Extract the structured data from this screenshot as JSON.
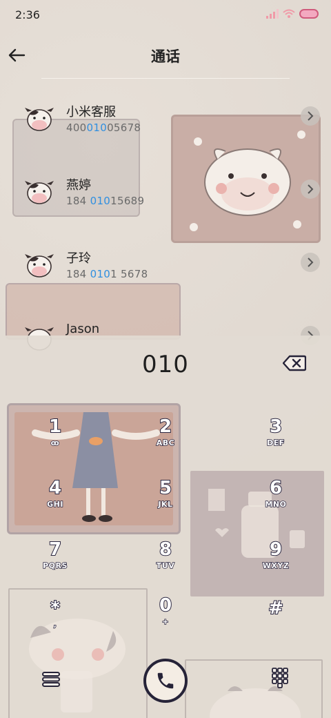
{
  "status_bar": {
    "time": "2:36"
  },
  "header": {
    "title": "通话"
  },
  "contacts": [
    {
      "name": "小米客服",
      "number_pre": "400",
      "number_hl": "010",
      "number_post": "05678"
    },
    {
      "name": "燕婷",
      "number_pre": "184 ",
      "number_hl": "010",
      "number_post": "15689"
    },
    {
      "name": "子玲",
      "number_pre": "184 ",
      "number_hl": "010",
      "number_post": "1 5678"
    },
    {
      "name": "Jason",
      "number_pre": "",
      "number_hl": "",
      "number_post": ""
    }
  ],
  "dialer": {
    "display": "010",
    "keys": [
      {
        "digit": "1",
        "letters": "ꝏ"
      },
      {
        "digit": "2",
        "letters": "ABC"
      },
      {
        "digit": "3",
        "letters": "DEF"
      },
      {
        "digit": "4",
        "letters": "GHI"
      },
      {
        "digit": "5",
        "letters": "JKL"
      },
      {
        "digit": "6",
        "letters": "MNO"
      },
      {
        "digit": "7",
        "letters": "PQRS"
      },
      {
        "digit": "8",
        "letters": "TUV"
      },
      {
        "digit": "9",
        "letters": "WXYZ"
      },
      {
        "digit": "*",
        "letters": ","
      },
      {
        "digit": "0",
        "letters": "+"
      },
      {
        "digit": "#",
        "letters": ""
      }
    ]
  },
  "icons": {
    "back": "arrow-left-icon",
    "chevron": "chevron-right-icon",
    "delete": "backspace-icon",
    "menu": "menu-icon",
    "call": "phone-icon",
    "dialpad": "dialpad-icon"
  },
  "colors": {
    "background": "#e2dbd3",
    "highlight": "#2f8fe0",
    "key_outline": "#2a2640",
    "battery": "#f3a9c0"
  }
}
